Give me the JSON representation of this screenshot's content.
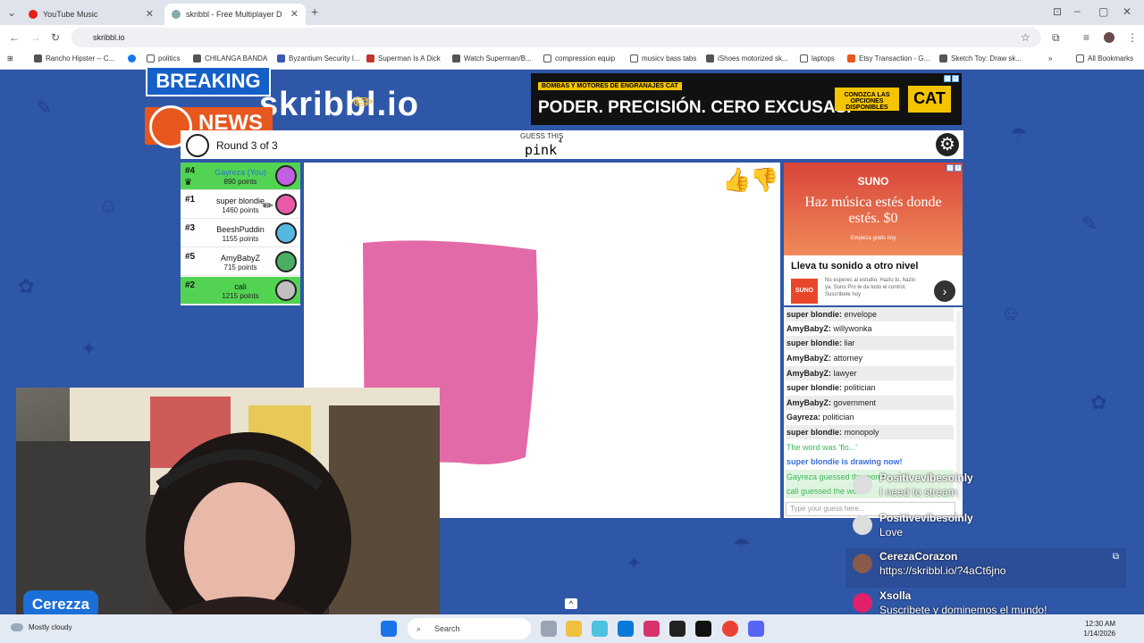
{
  "browser": {
    "tabs": [
      {
        "title": "YouTube Music",
        "active": false
      },
      {
        "title": "skribbl - Free Multiplayer D",
        "active": true
      }
    ],
    "url": "skribbl.io",
    "bookmarks": [
      "Rancho Hipster -- C...",
      "politics",
      "CHILANGA BANDA",
      "Byzantium Security I...",
      "Superman Is A Dick",
      "Watch Superman/B...",
      "compression equip",
      "musicv bass tabs",
      "iShoes motorized sk...",
      "laptops",
      "Etsy Transaction - G...",
      "Sketch Toy: Draw sk..."
    ],
    "all_bookmarks": "All Bookmarks"
  },
  "overlay": {
    "breaking": "BREAKING",
    "news": "NEWS"
  },
  "game": {
    "logo": "skribbl.io",
    "round": "Round 3 of 3",
    "guess_label": "GUESS THIS",
    "word": "pink",
    "word_length": "4",
    "players": [
      {
        "rank": "#4",
        "name": "Gayreza (You)",
        "points": "890 points",
        "color": "#52d452",
        "avatar": "#c060e0"
      },
      {
        "rank": "#1",
        "name": "super blondie",
        "points": "1460 points",
        "color": "#ffffff",
        "avatar": "#e85aa8"
      },
      {
        "rank": "#3",
        "name": "BeeshPuddin",
        "points": "1155 points",
        "color": "#ffffff",
        "avatar": "#56b8e0"
      },
      {
        "rank": "#5",
        "name": "AmyBabyZ",
        "points": "715 points",
        "color": "#ffffff",
        "avatar": "#49b063"
      },
      {
        "rank": "#2",
        "name": "cali",
        "points": "1215 points",
        "color": "#52d452",
        "avatar": "#c0c0c0"
      }
    ],
    "chat": [
      {
        "user": "super blondie:",
        "text": "envelope",
        "alt": true
      },
      {
        "user": "AmyBabyZ:",
        "text": "willywonka",
        "alt": false
      },
      {
        "user": "super blondie:",
        "text": "liar",
        "alt": true
      },
      {
        "user": "AmyBabyZ:",
        "text": "attorney",
        "alt": false
      },
      {
        "user": "AmyBabyZ:",
        "text": "lawyer",
        "alt": true
      },
      {
        "user": "super blondie:",
        "text": "politician",
        "alt": false
      },
      {
        "user": "AmyBabyZ:",
        "text": "government",
        "alt": true
      },
      {
        "user": "Gayreza:",
        "text": "politician",
        "alt": false
      },
      {
        "user": "super blondie:",
        "text": "monopoly",
        "alt": true
      }
    ],
    "system_lines": {
      "word_was": "The word was 'flo...'",
      "drawing": "super blondie is drawing now!",
      "guessed1": "Gayreza guessed the word!",
      "guessed2": "cali guessed the word!"
    },
    "chat_placeholder": "Type your guess here..."
  },
  "ads": {
    "top": {
      "tag": "BOMBAS Y MOTORES DE ENGRANAJES CAT",
      "headline": "PODER. PRECISIÓN. CERO EXCUSAS.",
      "cta": "CONOZCA LAS OPCIONES DISPONIBLES",
      "brand": "CAT"
    },
    "side": {
      "brand": "SUNO",
      "title": "Haz música estés donde estés. $0",
      "sub": "Empieza gratis hoy",
      "heading": "Lleva tu sonido a otro nivel",
      "body": "No esperes al estudio. Hazlo tú, hazlo ya. Suno Pro te da todo el control. Suscríbete hoy",
      "logo": "SUNO"
    }
  },
  "stream": {
    "cam_name": "Cerezza",
    "messages": [
      {
        "user": "Positivevibesoinly",
        "text": "I need to stream"
      },
      {
        "user": "Positivevibesoinly",
        "text": "Love"
      },
      {
        "user": "CerezaCorazon",
        "text": "https://skribbl.io/?4aCt6jno"
      },
      {
        "user": "Xsolla",
        "text": "Suscribete y dominemos el mundo!"
      }
    ]
  },
  "taskbar": {
    "weather": "Mostly cloudy",
    "search": "Search",
    "time": "12:30 AM",
    "date": "1/14/2026"
  }
}
